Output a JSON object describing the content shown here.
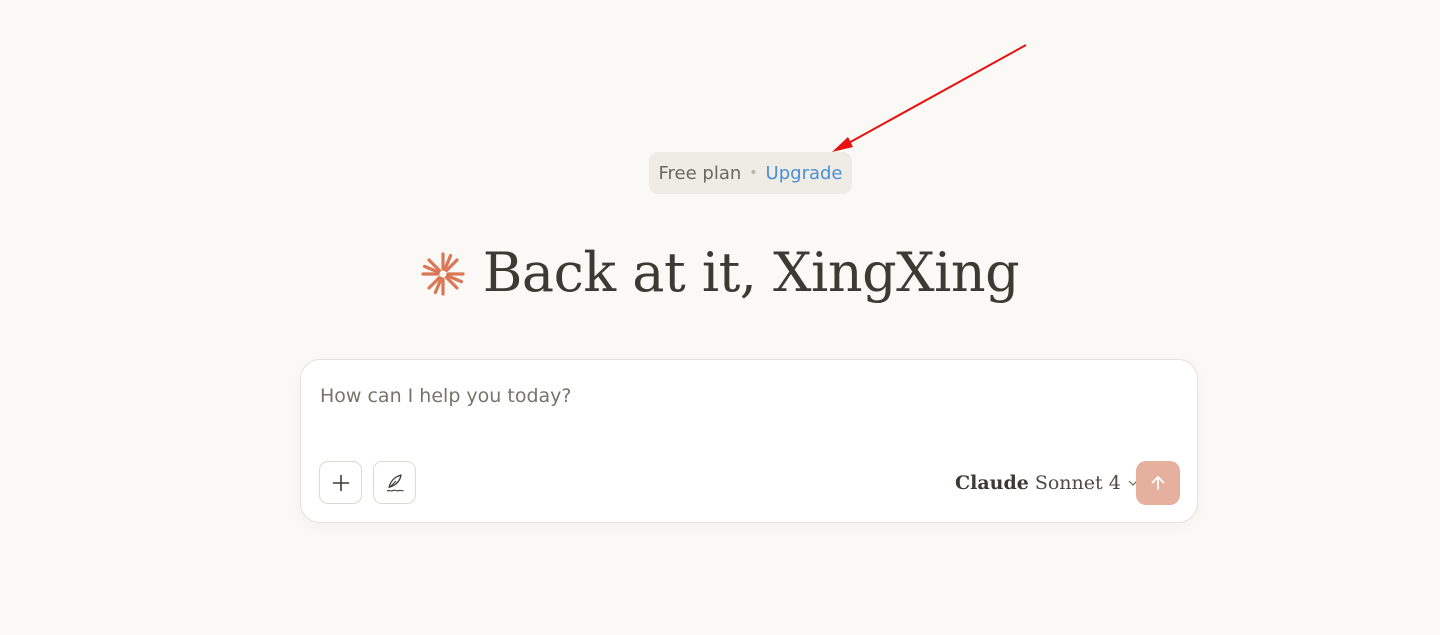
{
  "plan": {
    "label": "Free plan",
    "separator": "•",
    "upgrade_label": "Upgrade"
  },
  "greeting": {
    "text": "Back at it, XingXing",
    "icon": "spark-icon"
  },
  "composer": {
    "placeholder": "How can I help you today?",
    "value": "",
    "add_icon": "plus-icon",
    "style_icon": "quill-icon",
    "model_brand": "Claude",
    "model_name": "Sonnet 4",
    "dropdown_icon": "chevron-down-icon",
    "send_icon": "arrow-up-icon"
  },
  "colors": {
    "background": "#faf9f5",
    "accent": "#d97757",
    "link": "#4b8fd6",
    "send_button": "#e5b09e",
    "annotation_arrow": "#e81010"
  }
}
